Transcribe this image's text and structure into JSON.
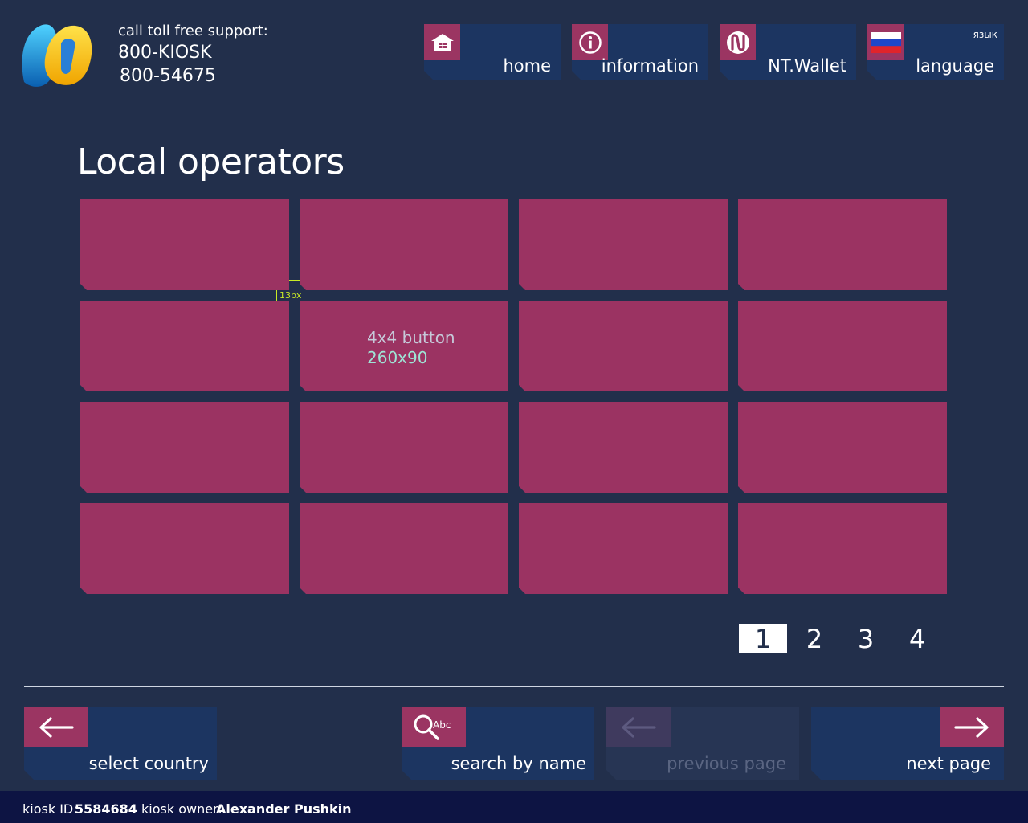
{
  "colors": {
    "background": "#222f4b",
    "accent": "#9b3562",
    "tile": "#9b3362",
    "nav": "#1c3561",
    "footer": "#0d1443",
    "annotation": "#c9ea25"
  },
  "header": {
    "support_label": "call toll free support:",
    "phone_1": "800-KIOSK",
    "phone_2": "800-54675",
    "nav": [
      {
        "label": "home",
        "icon": "home-icon"
      },
      {
        "label": "information",
        "icon": "info-icon"
      },
      {
        "label": "NT.Wallet",
        "icon": "wallet-icon"
      },
      {
        "label": "language",
        "sublabel": "язык",
        "icon": "russian-flag-icon"
      }
    ]
  },
  "main": {
    "title": "Local operators",
    "tile_note_line1": "4x4 button",
    "tile_note_line2": "260x90",
    "spacing_annotation": "13px",
    "pages": [
      "1",
      "2",
      "3",
      "4"
    ],
    "active_page": "1"
  },
  "bottom": {
    "select_country": "select country",
    "search_icon_text": "Abc",
    "search_by_name": "search by name",
    "previous_page": "previous page",
    "next_page": "next page"
  },
  "footer": {
    "kiosk_id_label": "kiosk ID:",
    "kiosk_id": "5584684",
    "owner_label": "kiosk owner:",
    "owner": "Alexander Pushkin"
  }
}
